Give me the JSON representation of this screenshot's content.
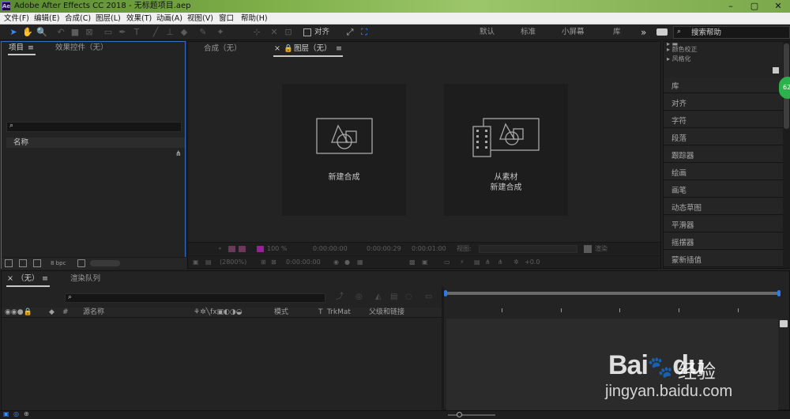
{
  "window": {
    "title": "Adobe After Effects CC 2018 - 无标题项目.aep",
    "logo_text": "Ae",
    "controls": [
      "–",
      "▢",
      "✕"
    ]
  },
  "menu": [
    "文件(F)",
    "编辑(E)",
    "合成(C)",
    "图层(L)",
    "效果(T)",
    "动画(A)",
    "视图(V)",
    "窗口",
    "帮助(H)"
  ],
  "toolbar": {
    "snap_label": "对齐",
    "workspaces": [
      "默认",
      "标准",
      "小屏幕",
      "库"
    ],
    "more": "»",
    "search_placeholder": "搜索帮助"
  },
  "project_panel": {
    "tab_project": "项目",
    "tab_effects": "效果控件（无）",
    "column_name": "名称",
    "bpc": "8 bpc"
  },
  "comp_panel": {
    "tab_comp": "合成（无）",
    "tab_layer": "图层（无）",
    "card_new_comp": "新建合成",
    "card_from_footage_1": "从素材",
    "card_from_footage_2": "新建合成",
    "footer": {
      "zoom": "100 %",
      "zoom2": "(2800%)",
      "time1": "0:00:00:00",
      "time2": "0:00:00:29",
      "time3": "0:00:01:00",
      "time4": "0:00:00:00",
      "view_label": "视图:",
      "render_label": "渲染",
      "offset": "+0.0"
    }
  },
  "right_panel": {
    "top_items": [
      "颜色校正",
      "风格化"
    ],
    "items": [
      "库",
      "对齐",
      "字符",
      "段落",
      "跟踪器",
      "绘画",
      "画笔",
      "动态草图",
      "平滑器",
      "摇摆器",
      "蒙新插值"
    ],
    "badge": "62"
  },
  "timeline": {
    "tab_none": "（无）",
    "tab_render": "渲染队列",
    "col_number": "#",
    "col_source": "源名称",
    "col_mode": "模式",
    "col_t": "T",
    "col_trkmat": "TrkMat",
    "col_parent": "父级和链接"
  },
  "watermark": {
    "brand": "Bai",
    "brand2": "du",
    "jy": "经验",
    "url": "jingyan.baidu.com"
  }
}
